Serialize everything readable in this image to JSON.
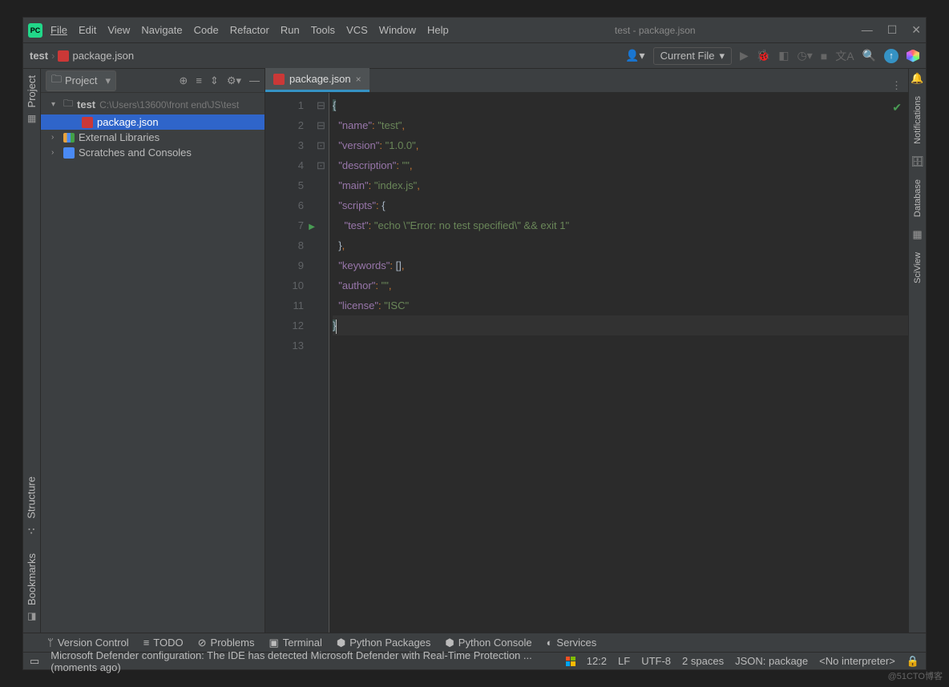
{
  "titlebar": {
    "menus": [
      "File",
      "Edit",
      "View",
      "Navigate",
      "Code",
      "Refactor",
      "Run",
      "Tools",
      "VCS",
      "Window",
      "Help"
    ],
    "title": "test - package.json"
  },
  "navbar": {
    "breadcrumb": [
      "test",
      "package.json"
    ],
    "run_config": "Current File"
  },
  "project_panel": {
    "title": "Project",
    "tree": {
      "root": {
        "name": "test",
        "path": "C:\\Users\\13600\\front end\\JS\\test"
      },
      "root_children": [
        {
          "name": "package.json"
        }
      ],
      "libs": "External Libraries",
      "scratches": "Scratches and Consoles"
    }
  },
  "left_tabs": [
    "Project",
    "Structure",
    "Bookmarks"
  ],
  "right_tabs": [
    "Notifications",
    "Database",
    "SciView"
  ],
  "editor": {
    "tab": "package.json",
    "lines": [
      "{",
      "  \"name\": \"test\",",
      "  \"version\": \"1.0.0\",",
      "  \"description\": \"\",",
      "  \"main\": \"index.js\",",
      "  \"scripts\": {",
      "    \"test\": \"echo \\\"Error: no test specified\\\" && exit 1\"",
      "  },",
      "  \"keywords\": [],",
      "  \"author\": \"\",",
      "  \"license\": \"ISC\"",
      "}",
      ""
    ]
  },
  "bottom_tools": [
    "Version Control",
    "TODO",
    "Problems",
    "Terminal",
    "Python Packages",
    "Python Console",
    "Services"
  ],
  "status": {
    "message": "Microsoft Defender configuration: The IDE has detected Microsoft Defender with Real-Time Protection ... (moments ago)",
    "pos": "12:2",
    "lineend": "LF",
    "enc": "UTF-8",
    "indent": "2 spaces",
    "schema": "JSON: package",
    "interp": "<No interpreter>"
  },
  "watermark": "@51CTO博客"
}
